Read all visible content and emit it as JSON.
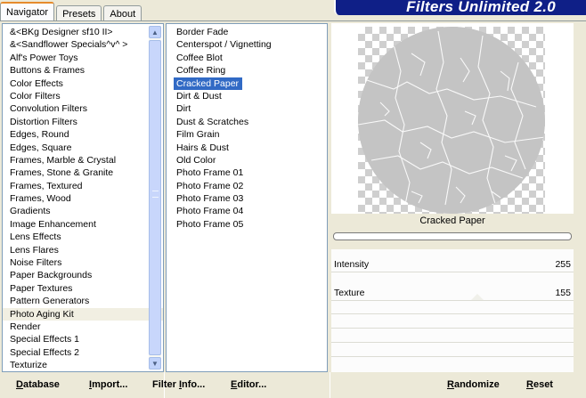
{
  "tabs": [
    {
      "label": "Navigator",
      "active": true
    },
    {
      "label": "Presets",
      "active": false
    },
    {
      "label": "About",
      "active": false
    }
  ],
  "banner": {
    "title": "Filters Unlimited 2.0",
    "color": "#0f1f87"
  },
  "categories": {
    "items": [
      "&<BKg Designer sf10 II>",
      "&<Sandflower Specials^v^ >",
      "Alf's Power Toys",
      "Buttons & Frames",
      "Color Effects",
      "Color Filters",
      "Convolution Filters",
      "Distortion Filters",
      "Edges, Round",
      "Edges, Square",
      "Frames, Marble & Crystal",
      "Frames, Stone & Granite",
      "Frames, Textured",
      "Frames, Wood",
      "Gradients",
      "Image Enhancement",
      "Lens Effects",
      "Lens Flares",
      "Noise Filters",
      "Paper Backgrounds",
      "Paper Textures",
      "Pattern Generators",
      "Photo Aging Kit",
      "Render",
      "Special Effects 1",
      "Special Effects 2",
      "Texturize"
    ],
    "selected": "Photo Aging Kit"
  },
  "filters": {
    "items": [
      "Border Fade",
      "Centerspot / Vignetting",
      "Coffee Blot",
      "Coffee Ring",
      "Cracked Paper",
      "Dirt & Dust",
      "Dirt",
      "Dust & Scratches",
      "Film Grain",
      "Hairs & Dust",
      "Old Color",
      "Photo Frame 01",
      "Photo Frame 02",
      "Photo Frame 03",
      "Photo Frame 04",
      "Photo Frame 05"
    ],
    "selected": "Cracked Paper"
  },
  "preview": {
    "label": "Cracked Paper",
    "progress": 0
  },
  "params": [
    {
      "name": "Intensity",
      "value": "255"
    },
    {
      "name": "Texture",
      "value": "155"
    }
  ],
  "footer": {
    "database": {
      "u": "D",
      "rest": "atabase"
    },
    "import": {
      "u": "I",
      "rest": "mport..."
    },
    "filter_info": {
      "pre": "Filter ",
      "u": "I",
      "rest": "nfo..."
    },
    "editor": {
      "u": "E",
      "rest": "ditor..."
    },
    "randomize": {
      "u": "R",
      "rest": "andomize"
    },
    "reset": {
      "u": "R",
      "rest": "eset"
    }
  },
  "colors": {
    "accent": "#316ac5",
    "tab_highlight": "#e68b2c"
  }
}
